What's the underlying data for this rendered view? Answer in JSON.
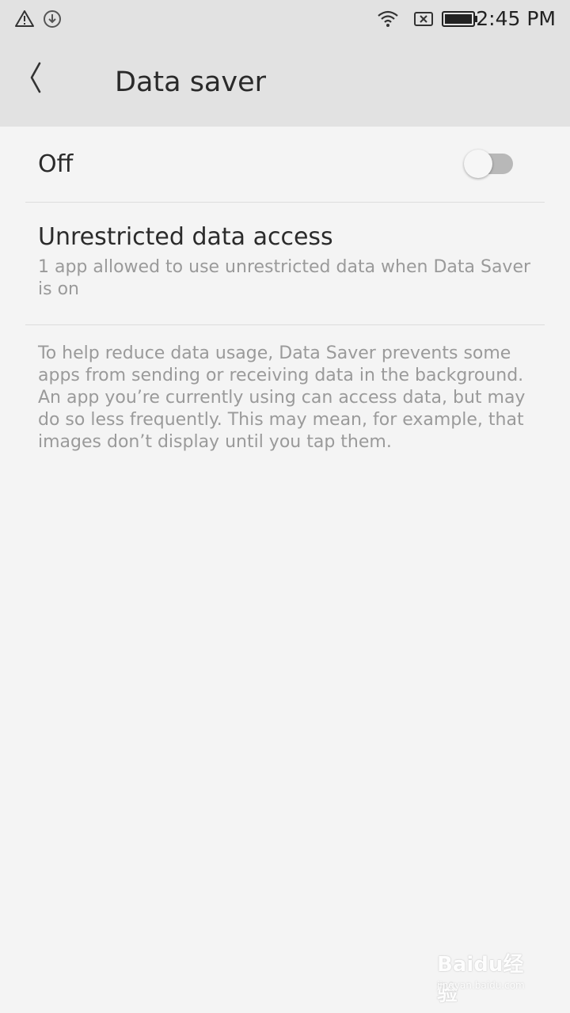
{
  "status_bar": {
    "time": "2:45 PM",
    "icons": [
      "warning-icon",
      "download-icon",
      "wifi-icon",
      "no-sim-icon",
      "battery-icon"
    ]
  },
  "header": {
    "back_icon": "chevron-left-icon",
    "title": "Data saver"
  },
  "toggle": {
    "label": "Off",
    "state": "off"
  },
  "unrestricted": {
    "title": "Unrestricted data access",
    "summary": "1 app allowed to use unrestricted data when Data Saver is on"
  },
  "description": "To help reduce data usage, Data Saver prevents some apps from sending or receiving data in the background. An app you’re currently using can access data, but may do so less frequently. This may mean, for example, that images don’t display until you tap them.",
  "watermark": {
    "brand": "Baidu经验",
    "url": "jingyan.baidu.com"
  },
  "colors": {
    "header_bg": "#e2e2e2",
    "page_bg": "#f4f4f4",
    "primary_text": "#2b2b2b",
    "secondary_text": "#9a9a9a",
    "switch_track_off": "#b8b8b8"
  }
}
